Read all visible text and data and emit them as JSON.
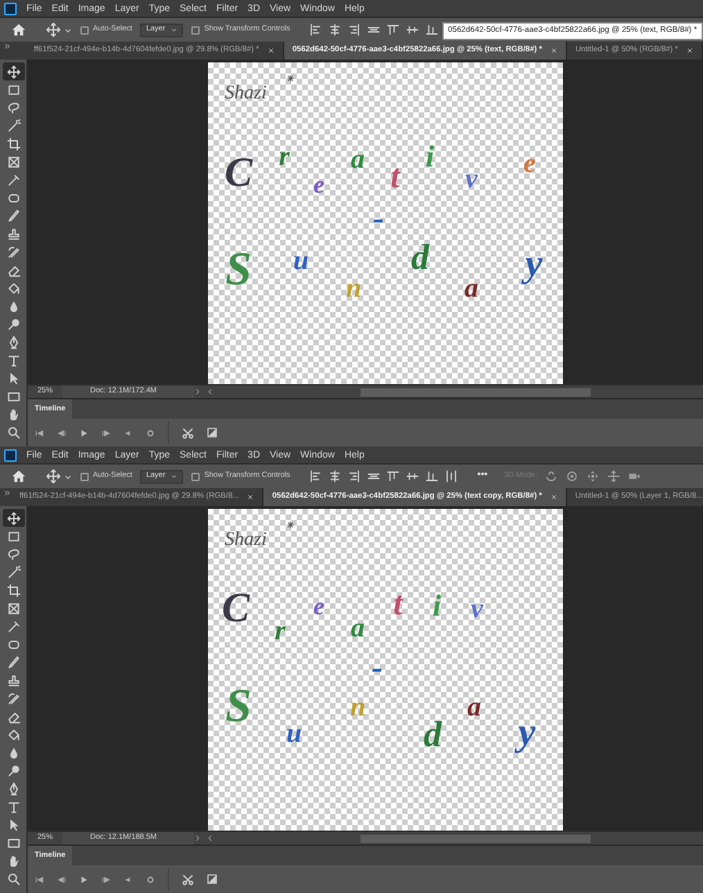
{
  "windows": [
    {
      "menu": [
        "File",
        "Edit",
        "Image",
        "Layer",
        "Type",
        "Select",
        "Filter",
        "3D",
        "View",
        "Window",
        "Help"
      ],
      "options": {
        "auto_select": {
          "label": "Auto-Select",
          "checked": false
        },
        "layer_dropdown": "Layer",
        "transform_controls": {
          "label": "Show Transform Controls",
          "checked": false
        }
      },
      "tabs": [
        {
          "label": "ff61f524-21cf-494e-b14b-4d7604fefde0.jpg @ 29.8% (RGB/8#) *",
          "selected": false
        },
        {
          "label": "0562d642-50cf-4776-aae3-c4bf25822a66.jpg @ 25% (text, RGB/8#) *",
          "selected": true
        },
        {
          "label": "Untitled-1 @ 50% (RGB/8#) *",
          "selected": false
        }
      ],
      "tooltip": "0562d642-50cf-4776-aae3-c4bf25822a66.jpg @ 25% (text, RGB/8#) *",
      "canvas": {
        "signature": "Shazi",
        "letters": [
          {
            "text": "C",
            "color": "#3c3a48"
          },
          {
            "text": "r",
            "color": "#2f7d3a"
          },
          {
            "text": "e",
            "color": "#7b5cc4"
          },
          {
            "text": "a",
            "color": "#2e8b3e"
          },
          {
            "text": "t",
            "color": "#c0506a"
          },
          {
            "text": "i",
            "color": "#3a9a4a"
          },
          {
            "text": "v",
            "color": "#5a6fd0"
          },
          {
            "text": "e",
            "color": "#d07840"
          },
          {
            "text": "-",
            "color": "#2060b0"
          },
          {
            "text": "S",
            "color": "#3f8f4a"
          },
          {
            "text": "u",
            "color": "#3060c0"
          },
          {
            "text": "n",
            "color": "#c0a030"
          },
          {
            "text": "d",
            "color": "#2a7a3a"
          },
          {
            "text": "a",
            "color": "#7a2a2a"
          },
          {
            "text": "y",
            "color": "#2a5ab0"
          }
        ]
      },
      "status": {
        "zoom": "25%",
        "doc": "Doc: 12.1M/172.4M"
      },
      "timeline": {
        "title": "Timeline"
      }
    },
    {
      "menu": [
        "File",
        "Edit",
        "Image",
        "Layer",
        "Type",
        "Select",
        "Filter",
        "3D",
        "View",
        "Window",
        "Help"
      ],
      "options": {
        "auto_select": {
          "label": "Auto-Select",
          "checked": false
        },
        "layer_dropdown": "Layer",
        "transform_controls": {
          "label": "Show Transform Controls",
          "checked": false
        },
        "more": "•••",
        "mode_label": "3D Mode:"
      },
      "tabs": [
        {
          "label": "ff61f524-21cf-494e-b14b-4d7604fefde0.jpg @ 29.8% (RGB/8...",
          "selected": false
        },
        {
          "label": "0562d642-50cf-4776-aae3-c4bf25822a66.jpg @ 25% (text copy, RGB/8#) *",
          "selected": true
        },
        {
          "label": "Untitled-1 @ 50% (Layer 1, RGB/8...",
          "selected": false
        }
      ],
      "canvas": {
        "signature": "Shazi",
        "letters": [
          {
            "text": "C",
            "color": "#3c3a48"
          },
          {
            "text": "r",
            "color": "#2f7d3a"
          },
          {
            "text": "e",
            "color": "#7b5cc4"
          },
          {
            "text": "a",
            "color": "#2e8b3e"
          },
          {
            "text": "t",
            "color": "#c0506a"
          },
          {
            "text": "i",
            "color": "#3a9a4a"
          },
          {
            "text": "v",
            "color": "#5a6fd0"
          },
          {
            "text": "-",
            "color": "#2060b0"
          },
          {
            "text": "S",
            "color": "#3f8f4a"
          },
          {
            "text": "u",
            "color": "#3060c0"
          },
          {
            "text": "n",
            "color": "#c0a030"
          },
          {
            "text": "d",
            "color": "#2a7a3a"
          },
          {
            "text": "a",
            "color": "#7a2a2a"
          },
          {
            "text": "y",
            "color": "#2a5ab0"
          }
        ]
      },
      "status": {
        "zoom": "25%",
        "doc": "Doc: 12.1M/188.5M"
      },
      "timeline": {
        "title": "Timeline"
      }
    }
  ]
}
